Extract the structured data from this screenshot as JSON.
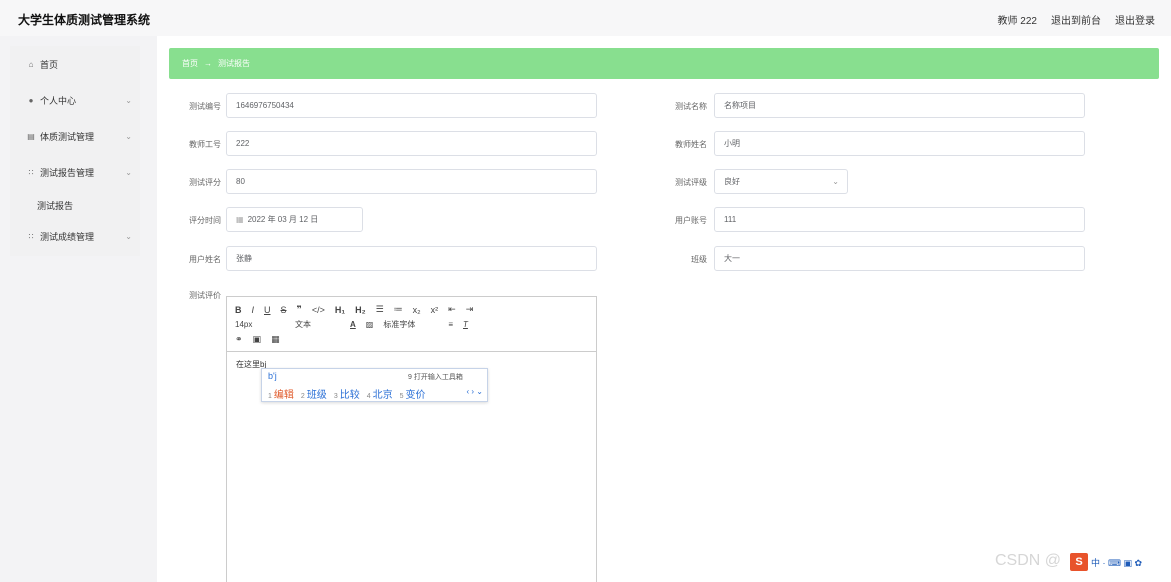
{
  "app": {
    "title": "大学生体质测试管理系统",
    "user": "教师 222",
    "back_to_front": "退出到前台",
    "logout": "退出登录"
  },
  "sidebar": {
    "items": [
      {
        "label": "首页",
        "icon": "home-icon"
      },
      {
        "label": "个人中心",
        "icon": "user-icon"
      },
      {
        "label": "体质测试管理",
        "icon": "doc-icon"
      },
      {
        "label": "测试报告管理",
        "icon": "grid-icon"
      },
      {
        "label": "测试成绩管理",
        "icon": "grid-icon"
      }
    ],
    "submenu_active": "测试报告"
  },
  "breadcrumb": {
    "home": "首页",
    "current": "测试报告"
  },
  "form": {
    "test_no_label": "测试编号",
    "test_no": "1646976750434",
    "test_name_label": "测试名称",
    "test_name": "名称项目",
    "teacher_id_label": "教师工号",
    "teacher_id": "222",
    "teacher_name_label": "教师姓名",
    "teacher_name": "小明",
    "score_label": "测试评分",
    "score": "80",
    "grade_label": "测试评级",
    "grade": "良好",
    "time_label": "评分时间",
    "time": "2022 年 03 月 12 日",
    "account_label": "用户账号",
    "account": "111",
    "username_label": "用户姓名",
    "username": "张静",
    "class_label": "班级",
    "class": "大一",
    "review_label": "测试评价"
  },
  "editor": {
    "font_size": "14px",
    "block_type": "文本",
    "font_family": "标准字体",
    "content": "在这里bj"
  },
  "ime": {
    "composition": "b'j",
    "hint": "9 打开输入工具箱",
    "candidates": [
      {
        "num": "1",
        "text": "编辑"
      },
      {
        "num": "2",
        "text": "班级"
      },
      {
        "num": "3",
        "text": "比较"
      },
      {
        "num": "4",
        "text": "北京"
      },
      {
        "num": "5",
        "text": "变价"
      }
    ]
  },
  "watermark": "CSDN @"
}
